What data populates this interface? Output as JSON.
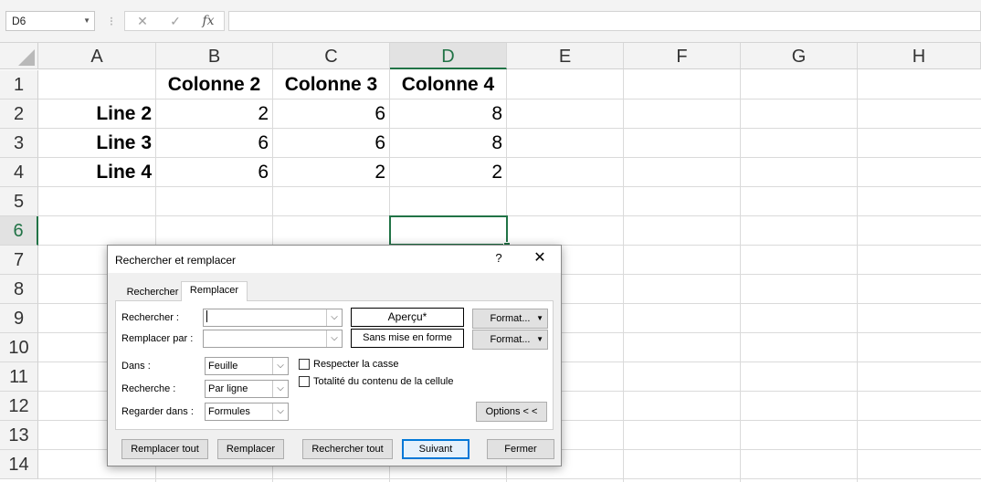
{
  "formula_bar": {
    "name_box": "D6",
    "cancel_icon": "✕",
    "enter_icon": "✓",
    "fx_label": "fx",
    "formula": ""
  },
  "columns": [
    "A",
    "B",
    "C",
    "D",
    "E",
    "F",
    "G",
    "H"
  ],
  "active_column": "D",
  "rows": [
    "1",
    "2",
    "3",
    "4",
    "5",
    "6",
    "7",
    "8",
    "9",
    "10",
    "11",
    "12",
    "13",
    "14"
  ],
  "active_row": "6",
  "cells": {
    "B1": "Colonne 2",
    "C1": "Colonne 3",
    "D1": "Colonne 4",
    "A2": "Line 2",
    "B2": "2",
    "C2": "6",
    "D2": "8",
    "A3": "Line 3",
    "B3": "6",
    "C3": "6",
    "D3": "8",
    "A4": "Line 4",
    "B4": "6",
    "C4": "2",
    "D4": "2"
  },
  "dialog": {
    "title": "Rechercher et remplacer",
    "help": "?",
    "close": "✕",
    "tabs": {
      "find": "Rechercher",
      "replace": "Remplacer"
    },
    "find_label": "Rechercher :",
    "find_value": "",
    "replace_label": "Remplacer par :",
    "replace_value": "",
    "preview_find": "Aperçu*",
    "preview_replace": "Sans mise en forme",
    "format_button": "Format...",
    "within_label": "Dans :",
    "within_value": "Feuille",
    "search_label": "Recherche :",
    "search_value": "Par ligne",
    "lookin_label": "Regarder dans :",
    "lookin_value": "Formules",
    "match_case": "Respecter la casse",
    "match_entire": "Totalité du contenu de la cellule",
    "options_button": "Options < <",
    "buttons": {
      "replace_all": "Remplacer tout",
      "replace": "Remplacer",
      "find_all": "Rechercher tout",
      "find_next": "Suivant",
      "close": "Fermer"
    }
  },
  "colors": {
    "accent": "#217346",
    "default_button": "#0078d7"
  }
}
